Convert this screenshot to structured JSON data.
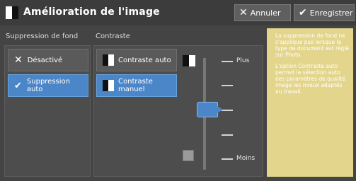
{
  "title": "Amélioration de l'image",
  "actions": {
    "cancel_label": "Annuler",
    "save_label": "Enregistrer"
  },
  "background_suppression": {
    "label": "Suppression de fond",
    "options": [
      {
        "label": "Désactivé",
        "selected": false
      },
      {
        "label": "Suppression auto",
        "selected": true
      }
    ]
  },
  "contrast": {
    "label": "Contraste",
    "options": [
      {
        "label": "Contraste auto",
        "selected": false
      },
      {
        "label": "Contraste manuel",
        "selected": true
      }
    ],
    "slider": {
      "top_label": "Plus",
      "bottom_label": "Moins",
      "levels": 5,
      "selected_level": 3
    }
  },
  "info": {
    "paragraph1": "La suppression de fond ne s'applique pas lorsque le type de document est réglé sur Photo.",
    "paragraph2": "L'option Contraste auto permet la sélection auto des paramètres de qualité image les mieux adaptés au travail."
  },
  "colors": {
    "selected": "#4b86c8",
    "info_panel": "#e4d58c",
    "title_bar": "#3c3c3c"
  },
  "icons": {
    "cancel": "x-icon",
    "save": "check-icon"
  }
}
